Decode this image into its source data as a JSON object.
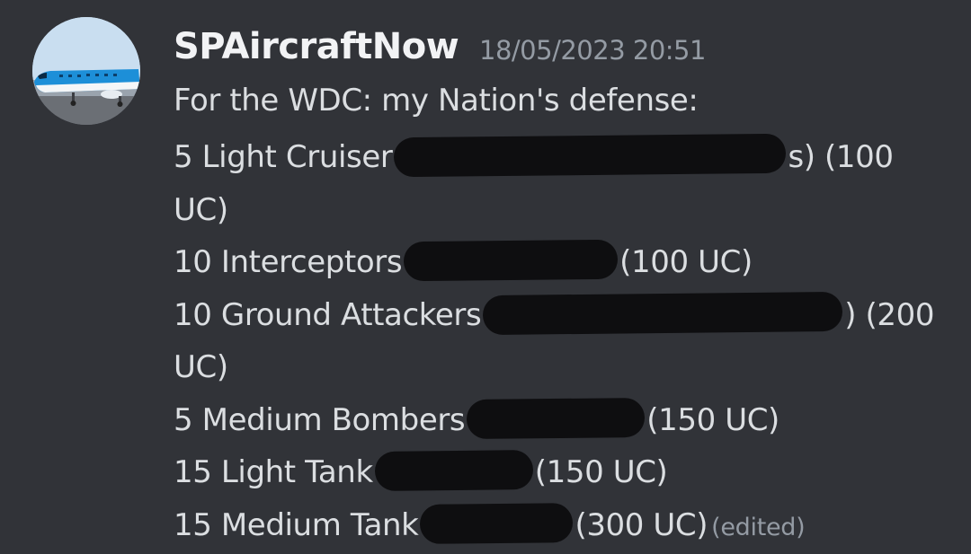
{
  "message": {
    "author": "SPAircraftNow",
    "timestamp": "18/05/2023 20:51",
    "intro": "For the WDC: my Nation's defense:",
    "lines": [
      {
        "before": "5 Light Cruiser",
        "after": "s) (100 UC)"
      },
      {
        "before": "10 Interceptors",
        "after": "(100 UC)"
      },
      {
        "before": "10 Ground Attackers",
        "after": ") (200 UC)"
      },
      {
        "before": "5 Medium Bombers",
        "after": "(150 UC)"
      },
      {
        "before": "15 Light Tank",
        "after": "(150 UC)"
      },
      {
        "before": "15 Medium Tank",
        "after": "(300 UC)"
      }
    ],
    "edited_label": "(edited)",
    "avatar_icon": "airplane-avatar-icon",
    "colors": {
      "background": "#313338",
      "username": "#f2f3f5",
      "text": "#dbdee1",
      "muted": "#949ba4",
      "redaction": "#0e0e10"
    }
  }
}
